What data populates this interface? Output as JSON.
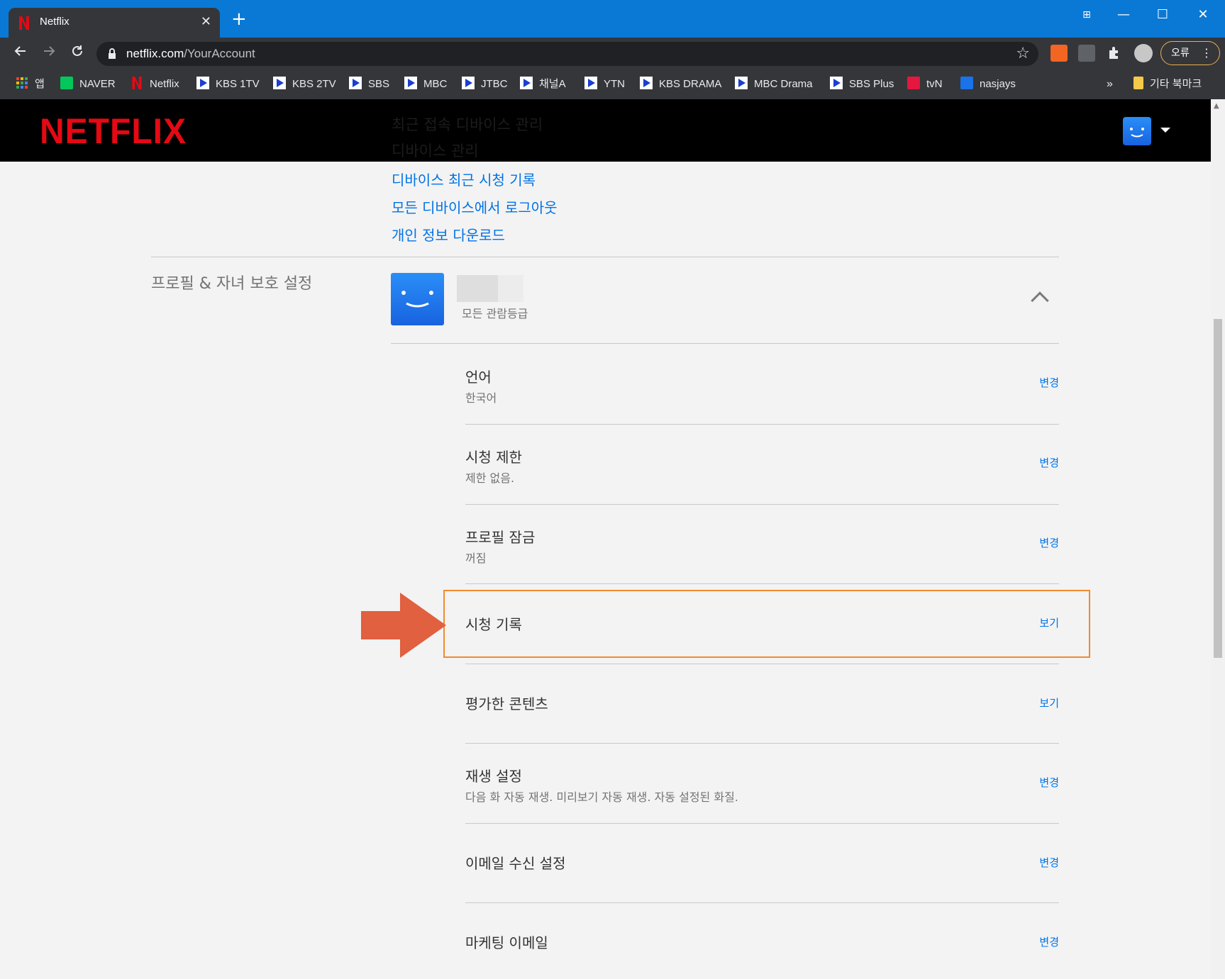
{
  "browser": {
    "tab_title": "Netflix",
    "tab_close": "✕",
    "new_tab": "+",
    "window_buttons": [
      "⊞",
      "—",
      "☐",
      "✕"
    ],
    "url_host": "netflix.com",
    "url_path": "/YourAccount",
    "error_label": "오류",
    "bookmarks": [
      {
        "label": "앱",
        "icon": "apps-grid-icon"
      },
      {
        "label": "NAVER",
        "icon": "naver-icon"
      },
      {
        "label": "Netflix",
        "icon": "netflix-icon"
      },
      {
        "label": "KBS 1TV",
        "icon": "play-icon"
      },
      {
        "label": "KBS 2TV",
        "icon": "play-icon"
      },
      {
        "label": "SBS",
        "icon": "play-icon"
      },
      {
        "label": "MBC",
        "icon": "play-icon"
      },
      {
        "label": "JTBC",
        "icon": "play-icon"
      },
      {
        "label": "채널A",
        "icon": "play-icon"
      },
      {
        "label": "YTN",
        "icon": "play-icon"
      },
      {
        "label": "KBS DRAMA",
        "icon": "play-icon"
      },
      {
        "label": "MBC Drama",
        "icon": "play-icon"
      },
      {
        "label": "SBS Plus",
        "icon": "play-icon"
      },
      {
        "label": "tvN",
        "icon": "tvn-icon"
      },
      {
        "label": "nasjays",
        "icon": "dsm-icon"
      }
    ],
    "bookmarks_overflow": "»",
    "other_bookmarks": "기타 북마크"
  },
  "header": {
    "logo": "NETFLIX",
    "hidden_line_1": "최근 접속 디바이스 관리",
    "hidden_line_2": "디바이스 관리"
  },
  "account_links": [
    "디바이스 최근 시청 기록",
    "모든 디바이스에서 로그아웃",
    "개인 정보 다운로드"
  ],
  "profile_section": {
    "title": "프로필 & 자녀 보호 설정",
    "rating": "모든 관람등급",
    "rows": [
      {
        "label": "언어",
        "sub": "한국어",
        "action": "변경"
      },
      {
        "label": "시청 제한",
        "sub": "제한 없음.",
        "action": "변경"
      },
      {
        "label": "프로필 잠금",
        "sub": "꺼짐",
        "action": "변경"
      },
      {
        "label": "시청 기록",
        "sub": "",
        "action": "보기"
      },
      {
        "label": "평가한 콘텐츠",
        "sub": "",
        "action": "보기"
      },
      {
        "label": "재생 설정",
        "sub": "다음 화 자동 재생. 미리보기 자동 재생. 자동 설정된 화질.",
        "action": "변경"
      },
      {
        "label": "이메일 수신 설정",
        "sub": "",
        "action": "변경"
      },
      {
        "label": "마케팅 이메일",
        "sub": "",
        "action": "변경"
      }
    ]
  },
  "colors": {
    "netflix_red": "#e50914",
    "link_blue": "#0073e6",
    "highlight_orange": "#f28a2d",
    "arrow": "#e06040",
    "chrome_blue": "#0a79d6"
  }
}
